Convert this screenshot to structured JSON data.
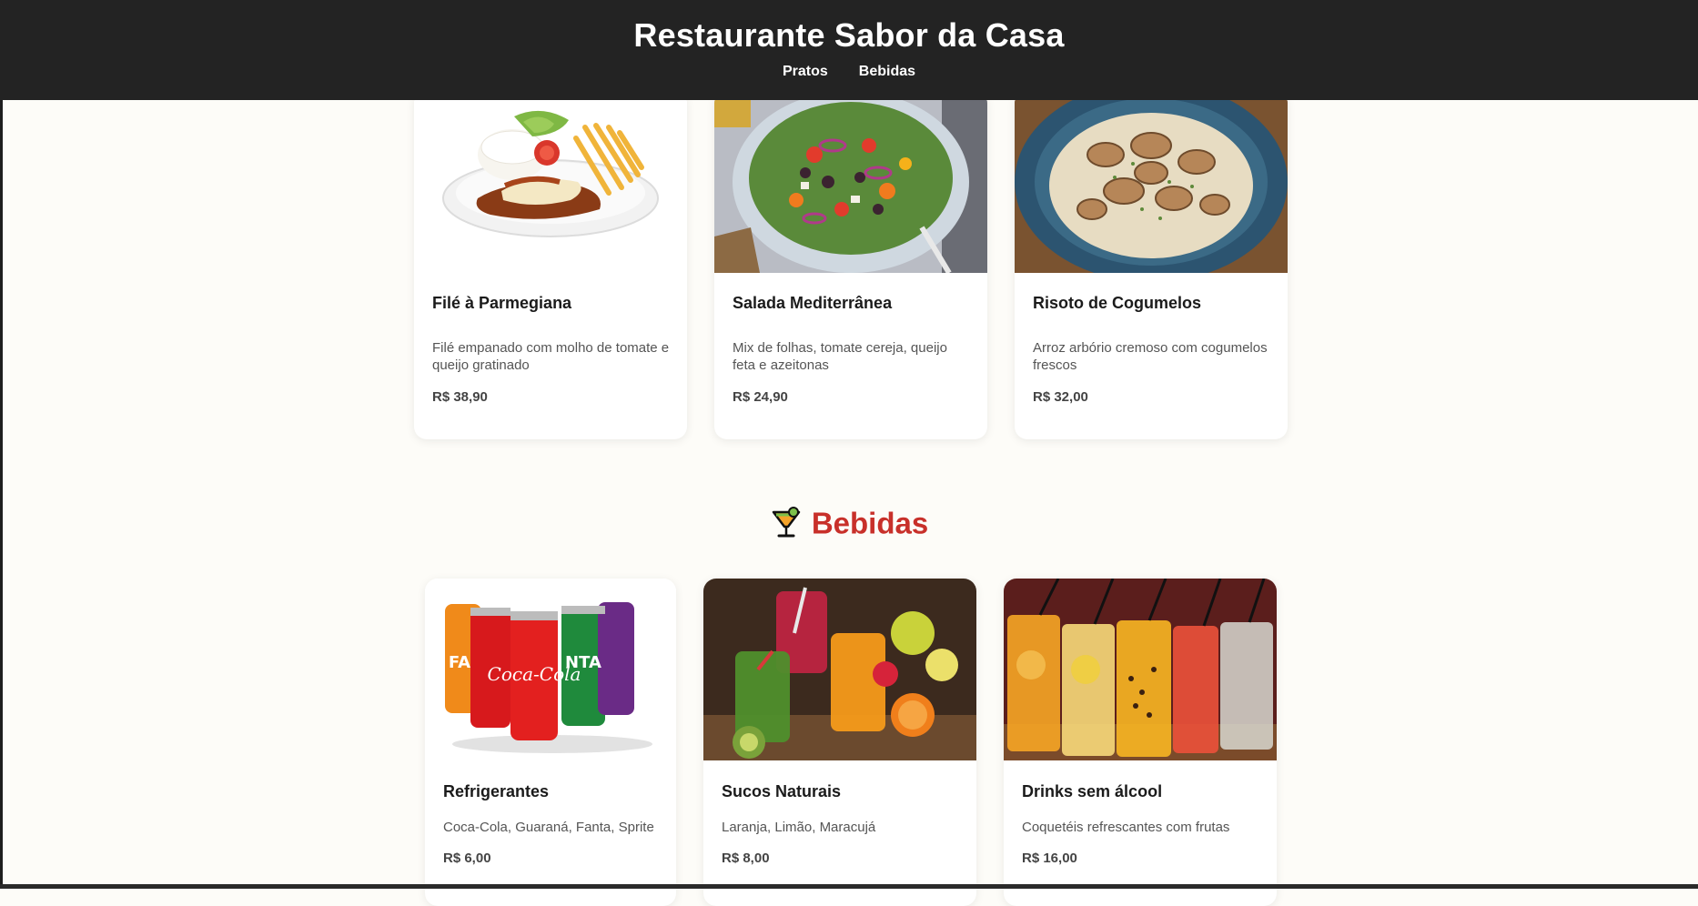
{
  "header": {
    "title": "Restaurante Sabor da Casa",
    "nav": [
      {
        "label": "Pratos"
      },
      {
        "label": "Bebidas"
      }
    ]
  },
  "pratos": [
    {
      "name": "Filé à Parmegiana",
      "description": "Filé empanado com molho de tomate e queijo gratinado",
      "price": "R$ 38,90",
      "image_icon": "parmegiana-plate-image"
    },
    {
      "name": "Salada Mediterrânea",
      "description": "Mix de folhas, tomate cereja, queijo feta e azeitonas",
      "price": "R$ 24,90",
      "image_icon": "salad-bowl-image"
    },
    {
      "name": "Risoto de Cogumelos",
      "description": "Arroz arbório cremoso com cogumelos frescos",
      "price": "R$ 32,00",
      "image_icon": "mushroom-risotto-image"
    }
  ],
  "bebidas_section": {
    "title": "Bebidas",
    "icon": "cocktail-icon"
  },
  "bebidas": [
    {
      "name": "Refrigerantes",
      "description": "Coca-Cola, Guaraná, Fanta, Sprite",
      "price": "R$ 6,00",
      "image_icon": "soda-cans-image"
    },
    {
      "name": "Sucos Naturais",
      "description": "Laranja, Limão, Maracujá",
      "price": "R$ 8,00",
      "image_icon": "fruit-juices-image"
    },
    {
      "name": "Drinks sem álcool",
      "description": "Coquetéis refrescantes com frutas",
      "price": "R$ 16,00",
      "image_icon": "mocktails-image"
    }
  ],
  "colors": {
    "header_bg": "#232323",
    "page_bg": "#fdfcf8",
    "accent_red": "#c8302a"
  }
}
